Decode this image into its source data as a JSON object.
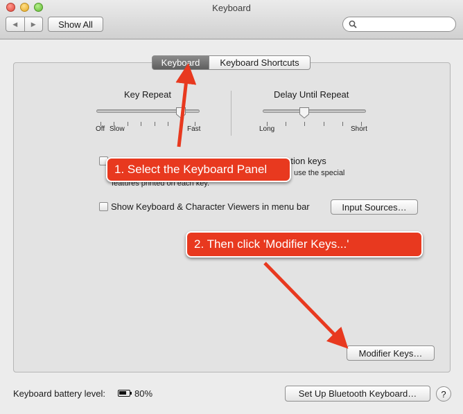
{
  "window": {
    "title": "Keyboard"
  },
  "toolbar": {
    "back_glyph": "◀",
    "forward_glyph": "▶",
    "show_all": "Show All",
    "search_placeholder": ""
  },
  "tabs": [
    {
      "label": "Keyboard",
      "selected": true
    },
    {
      "label": "Keyboard Shortcuts",
      "selected": false
    }
  ],
  "key_repeat": {
    "title": "Key Repeat",
    "min_labels": [
      "Off",
      "Slow"
    ],
    "max_label": "Fast",
    "value_fraction": 0.82
  },
  "delay_until_repeat": {
    "title": "Delay Until Repeat",
    "min_label": "Long",
    "max_label": "Short",
    "value_fraction": 0.4
  },
  "fn_keys": {
    "label_visible_start": "U",
    "label_visible_end": "d function keys",
    "description_end": "use the special",
    "description_line2": "features printed on each key.",
    "checked": false
  },
  "viewers": {
    "label": "Show Keyboard & Character Viewers in menu bar",
    "checked": false
  },
  "buttons": {
    "input_sources": "Input Sources…",
    "modifier_keys": "Modifier Keys…",
    "setup_bluetooth": "Set Up Bluetooth Keyboard…",
    "help": "?"
  },
  "battery": {
    "label": "Keyboard battery level:",
    "percent_text": "80%",
    "level": 0.8
  },
  "annotations": {
    "step1": "1. Select the Keyboard Panel",
    "step2": "2. Then click 'Modifier Keys...'"
  },
  "colors": {
    "annotation_red": "#e8391f",
    "selected_tab": "#6a6a6a"
  },
  "icons": {
    "search": "search-icon",
    "battery": "battery-icon",
    "arrow": "red-arrow"
  }
}
